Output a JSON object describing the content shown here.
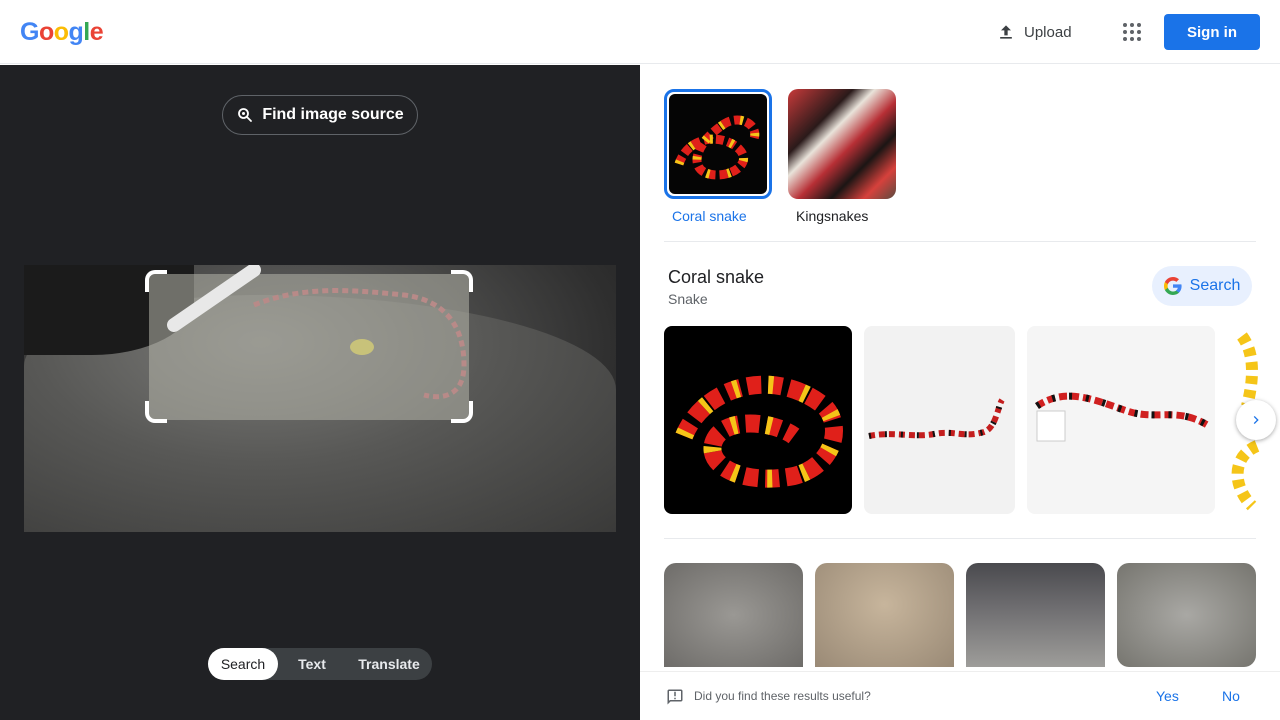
{
  "header": {
    "logo_letters": [
      "G",
      "o",
      "o",
      "g",
      "l",
      "e"
    ],
    "upload_label": "Upload",
    "signin_label": "Sign in",
    "brand_color": "#1a73e8"
  },
  "lens": {
    "find_source_label": "Find image source",
    "modes": [
      "Search",
      "Text",
      "Translate"
    ],
    "active_mode": "Search"
  },
  "results": {
    "chips": [
      {
        "label": "Coral snake",
        "selected": true
      },
      {
        "label": "Kingsnakes",
        "selected": false
      }
    ],
    "entity": {
      "title": "Coral snake",
      "subtitle": "Snake",
      "search_label": "Search"
    }
  },
  "feedback": {
    "question": "Did you find these results useful?",
    "yes_label": "Yes",
    "no_label": "No"
  }
}
